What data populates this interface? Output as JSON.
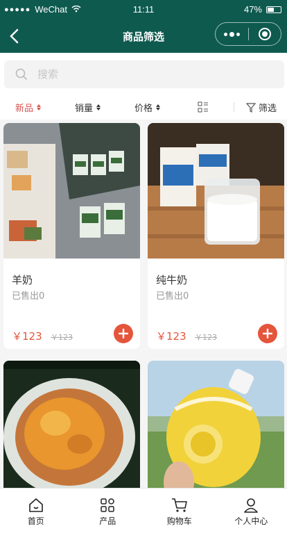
{
  "status_bar": {
    "carrier": "WeChat",
    "time": "11:11",
    "battery": "47%"
  },
  "nav": {
    "title": "商品筛选"
  },
  "search": {
    "placeholder": "搜索"
  },
  "sort": {
    "items": [
      "新品",
      "销量",
      "价格"
    ],
    "active": "新品",
    "filter_label": "筛选"
  },
  "products": [
    {
      "name": "羊奶",
      "sold": "已售出0",
      "price": "￥123",
      "original_price": "￥123"
    },
    {
      "name": "纯牛奶",
      "sold": "已售出0",
      "price": "￥123",
      "original_price": "￥123"
    },
    {
      "name": "",
      "sold": "",
      "price": "",
      "original_price": ""
    },
    {
      "name": "",
      "sold": "",
      "price": "",
      "original_price": ""
    }
  ],
  "tabbar": {
    "items": [
      "首页",
      "产品",
      "购物车",
      "个人中心"
    ]
  },
  "colors": {
    "brand": "#0f5a4f",
    "accent": "#e4553c",
    "active_sort": "#d9534f"
  }
}
